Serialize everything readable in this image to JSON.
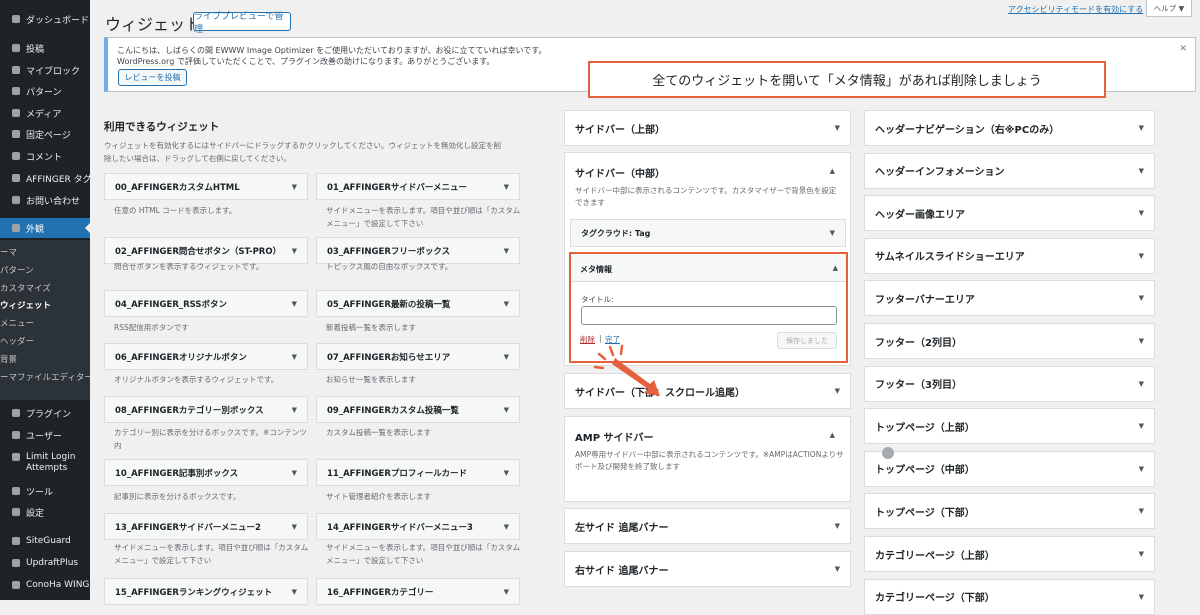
{
  "sidebar": {
    "items": [
      {
        "label": "ダッシュボード"
      },
      {
        "label": "投稿"
      },
      {
        "label": "マイブロック"
      },
      {
        "label": "パターン"
      },
      {
        "label": "メディア"
      },
      {
        "label": "固定ページ"
      },
      {
        "label": "コメント"
      },
      {
        "label": "AFFINGER タグ"
      },
      {
        "label": "お問い合わせ"
      },
      {
        "label": "外観"
      },
      {
        "label": "プラグイン"
      },
      {
        "label": "ユーザー"
      },
      {
        "label": "Limit Login"
      },
      {
        "label": "Attempts"
      },
      {
        "label": "ツール"
      },
      {
        "label": "設定"
      },
      {
        "label": "SiteGuard"
      },
      {
        "label": "UpdraftPlus"
      },
      {
        "label": "ConoHa WING"
      }
    ],
    "submenu": [
      "ーマ",
      "パターン",
      "カスタマイズ",
      "ウィジェット",
      "メニュー",
      "ヘッダー",
      "背景",
      "ーマファイルエディター"
    ]
  },
  "header": {
    "title": "ウィジェット",
    "preview_button": "ライブプレビューで管理",
    "accessibility_link": "アクセシビリティモードを有効にする",
    "help_button": "ヘルプ ▼"
  },
  "notice": {
    "line1": "こんにちは、しばらくの間 EWWW Image Optimizer をご使用いただいておりますが、お役に立てていれば幸いです。",
    "line2": "WordPress.org で評価していただくことで、プラグイン改善の助けになります。ありがとうございます。",
    "review_button": "レビューを投稿",
    "close": "✕"
  },
  "callout": {
    "text": "全てのウィジェットを開いて「メタ情報」があれば削除しましょう"
  },
  "available": {
    "title": "利用できるウィジェット",
    "description1": "ウィジェットを有効化するにはサイドバーにドラッグするかクリックしてください。ウィジェットを無効化し設定を削",
    "description2": "除したい場合は、ドラッグして右側に戻してください。",
    "widgets": [
      {
        "name": "00_AFFINGERカスタムHTML",
        "desc": "任意の HTML コードを表示します。"
      },
      {
        "name": "01_AFFINGERサイドバーメニュー",
        "desc": "サイドメニューを表示します。項目や並び順は「カスタムメニュー」で設定して下さい"
      },
      {
        "name": "02_AFFINGER問合せボタン（ST-PRO）",
        "desc": "問合せボタンを表示するウィジェットです。"
      },
      {
        "name": "03_AFFINGERフリーボックス",
        "desc": "トピックス風の自由なボックスです。"
      },
      {
        "name": "04_AFFINGER_RSSボタン",
        "desc": "RSS配信用ボタンです"
      },
      {
        "name": "05_AFFINGER最新の投稿一覧",
        "desc": "新着投稿一覧を表示します"
      },
      {
        "name": "06_AFFINGERオリジナルボタン",
        "desc": "オリジナルボタンを表示するウィジェットです。"
      },
      {
        "name": "07_AFFINGERお知らせエリア",
        "desc": "お知らせ一覧を表示します"
      },
      {
        "name": "08_AFFINGERカテゴリー別ボックス",
        "desc": "カテゴリー別に表示を分けるボックスです。※コンテンツ内"
      },
      {
        "name": "09_AFFINGERカスタム投稿一覧",
        "desc": "カスタム投稿一覧を表示します"
      },
      {
        "name": "10_AFFINGER記事別ボックス",
        "desc": "記事別に表示を分けるボックスです。"
      },
      {
        "name": "11_AFFINGERプロフィールカード",
        "desc": "サイト管理者紹介を表示します"
      },
      {
        "name": "13_AFFINGERサイドバーメニュー2",
        "desc": "サイドメニューを表示します。項目や並び順は「カスタムメニュー」で設定して下さい"
      },
      {
        "name": "14_AFFINGERサイドバーメニュー3",
        "desc": "サイドメニューを表示します。項目や並び順は「カスタムメニュー」で設定して下さい"
      },
      {
        "name": "15_AFFINGERランキングウィジェット",
        "desc": ""
      },
      {
        "name": "16_AFFINGERカテゴリー",
        "desc": ""
      }
    ]
  },
  "middle": {
    "side_top": "サイドバー（上部）",
    "side_mid": "サイドバー（中部）",
    "side_mid_desc": "サイドバー中部に表示されるコンテンツです。カスタマイザーで背景色を設定できます",
    "tagcloud": "タグクラウド: Tag",
    "meta": {
      "title": "メタ情報",
      "field_label": "タイトル:",
      "field_value": "",
      "delete": "削除",
      "sep": "|",
      "done": "完了",
      "saved": "保存しました"
    },
    "side_bottom": "サイドバー（下部：スクロール追尾）",
    "amp": "AMP サイドバー",
    "amp_desc": "AMP専用サイドバー中部に表示されるコンテンツです。※AMPはACTIONよりサポート及び開発を終了致します",
    "left_banner": "左サイド 追尾バナー",
    "right_banner": "右サイド 追尾バナー"
  },
  "right": {
    "areas": [
      "ヘッダーナビゲーション（右※PCのみ）",
      "ヘッダーインフォメーション",
      "ヘッダー画像エリア",
      "サムネイルスライドショーエリア",
      "フッターバナーエリア",
      "フッター（2列目）",
      "フッター（3列目）",
      "トップページ（上部）",
      "トップページ（中部）",
      "トップページ（下部）",
      "カテゴリーページ（上部）",
      "カテゴリーページ（下部）"
    ]
  },
  "colors": {
    "accent": "#2271b1",
    "callout": "#e5603c",
    "sidebar": "#1d2327"
  }
}
